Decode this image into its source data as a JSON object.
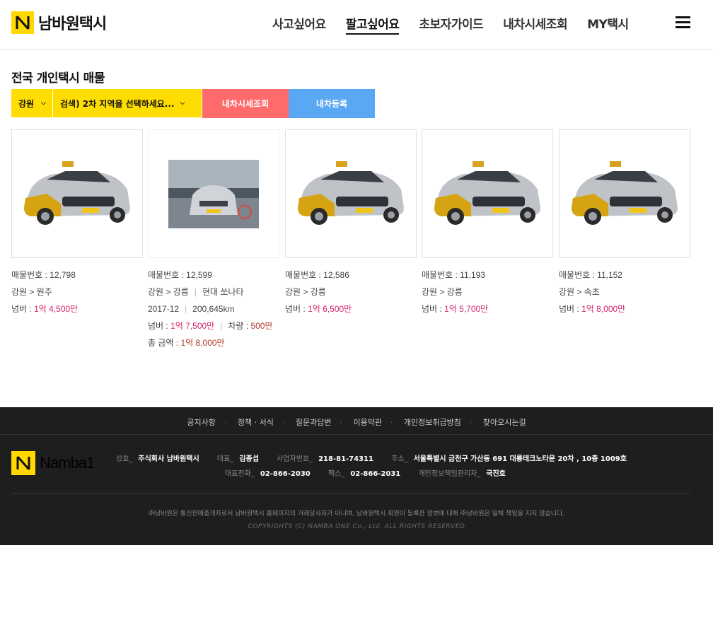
{
  "header": {
    "logo_text": "남바원택시",
    "nav": [
      "사고싶어요",
      "팔고싶어요",
      "초보자가이드",
      "내차시세조회",
      "MY택시"
    ],
    "active_nav": "팔고싶어요"
  },
  "section": {
    "title": "전국 개인택시 매물",
    "region_select": "강원",
    "subregion_select": "검색) 2차 지역을 선택하세요...",
    "lookup_button": "내차시세조회",
    "register_button": "내차등록"
  },
  "listings": [
    {
      "number_label": "매물번호 : 12,798",
      "location": "강원 > 원주",
      "price_label": "넘버 : ",
      "price": "1억 4,500만",
      "image": "taxi-illustration"
    },
    {
      "number_label": "매물번호 : 12,599",
      "location": "강원 > 강릉",
      "model": "현대 쏘나타",
      "year": "2017-12",
      "mileage": "200,645km",
      "price_label": "넘버 : ",
      "price": "1억 7,500만",
      "vehicle_label": "차량 : ",
      "vehicle_price": "500만",
      "total_label": "총 금액 : ",
      "total_price": "1억 8,000만",
      "image": "taxi-photo"
    },
    {
      "number_label": "매물번호 : 12,586",
      "location": "강원 > 강릉",
      "price_label": "넘버 : ",
      "price": "1억 6,500만",
      "image": "taxi-illustration"
    },
    {
      "number_label": "매물번호 : 11,193",
      "location": "강원 > 강릉",
      "price_label": "넘버 : ",
      "price": "1억 5,700만",
      "image": "taxi-illustration"
    },
    {
      "number_label": "매물번호 : 11,152",
      "location": "강원 > 속초",
      "price_label": "넘버 : ",
      "price": "1억 8,000만",
      "image": "taxi-illustration"
    }
  ],
  "footer": {
    "links": [
      "공지사항",
      "정책 · 서식",
      "질문과답변",
      "이용약관",
      "개인정보취급방침",
      "찾아오시는길"
    ],
    "logo_text": "Namba1",
    "company_key": "상호_",
    "company": "주식회사 남바원택시",
    "ceo_key": "대표_",
    "ceo": "김종섭",
    "bizno_key": "사업자번호_",
    "bizno": "218-81-74311",
    "addr_key": "주소_",
    "addr": "서울특별시 금천구 가산동 691 대륭테크노타운 20차 , 10층 1009호",
    "tel_key": "대표전화_",
    "tel": "02-866-2030",
    "fax_key": "팩스_",
    "fax": "02-866-2031",
    "privacy_key": "개인정보책임관리자_",
    "privacy": "국진호",
    "disclaimer": "㈜남바원은 통신판매중개자로서 남바원택시 홈페이지의 거래당사자가 아니며, 남바원택시 회원이 등록한 정보에 대해 ㈜남바원은 일체 책임을 지지 않습니다.",
    "copyright": "COPYRIGHTS (C) NAMBA ONE Co., Ltd. ALL RIGHTS RESERVED"
  },
  "colors": {
    "brand_yellow": "#ffd800",
    "lookup_red": "#ff6b6b",
    "register_blue": "#5aa7f4",
    "price_pink": "#d6246b",
    "footer_bg": "#1e1e1e"
  }
}
